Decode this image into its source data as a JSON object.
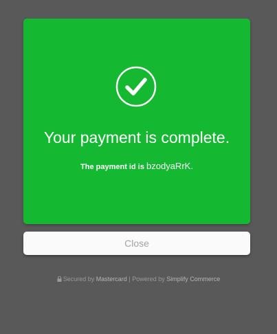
{
  "card": {
    "icon": "check-circle-icon",
    "title": "Your payment is complete.",
    "payment_id_prefix": "The payment id is",
    "payment_id": "bzodyaRrK",
    "payment_id_suffix": ".",
    "color": "#14b831"
  },
  "close_button": {
    "label": "Close"
  },
  "footer": {
    "lock_icon": "lock-icon",
    "secured_by": "Secured by",
    "secured_brand": "Mastercard",
    "separator": "|",
    "powered_by": "Powered by",
    "powered_brand": "Simplify Commerce"
  },
  "colors": {
    "background": "#595959",
    "success_green": "#14b831",
    "button_bg": "#fafafa",
    "button_text": "#a3a3a3"
  }
}
